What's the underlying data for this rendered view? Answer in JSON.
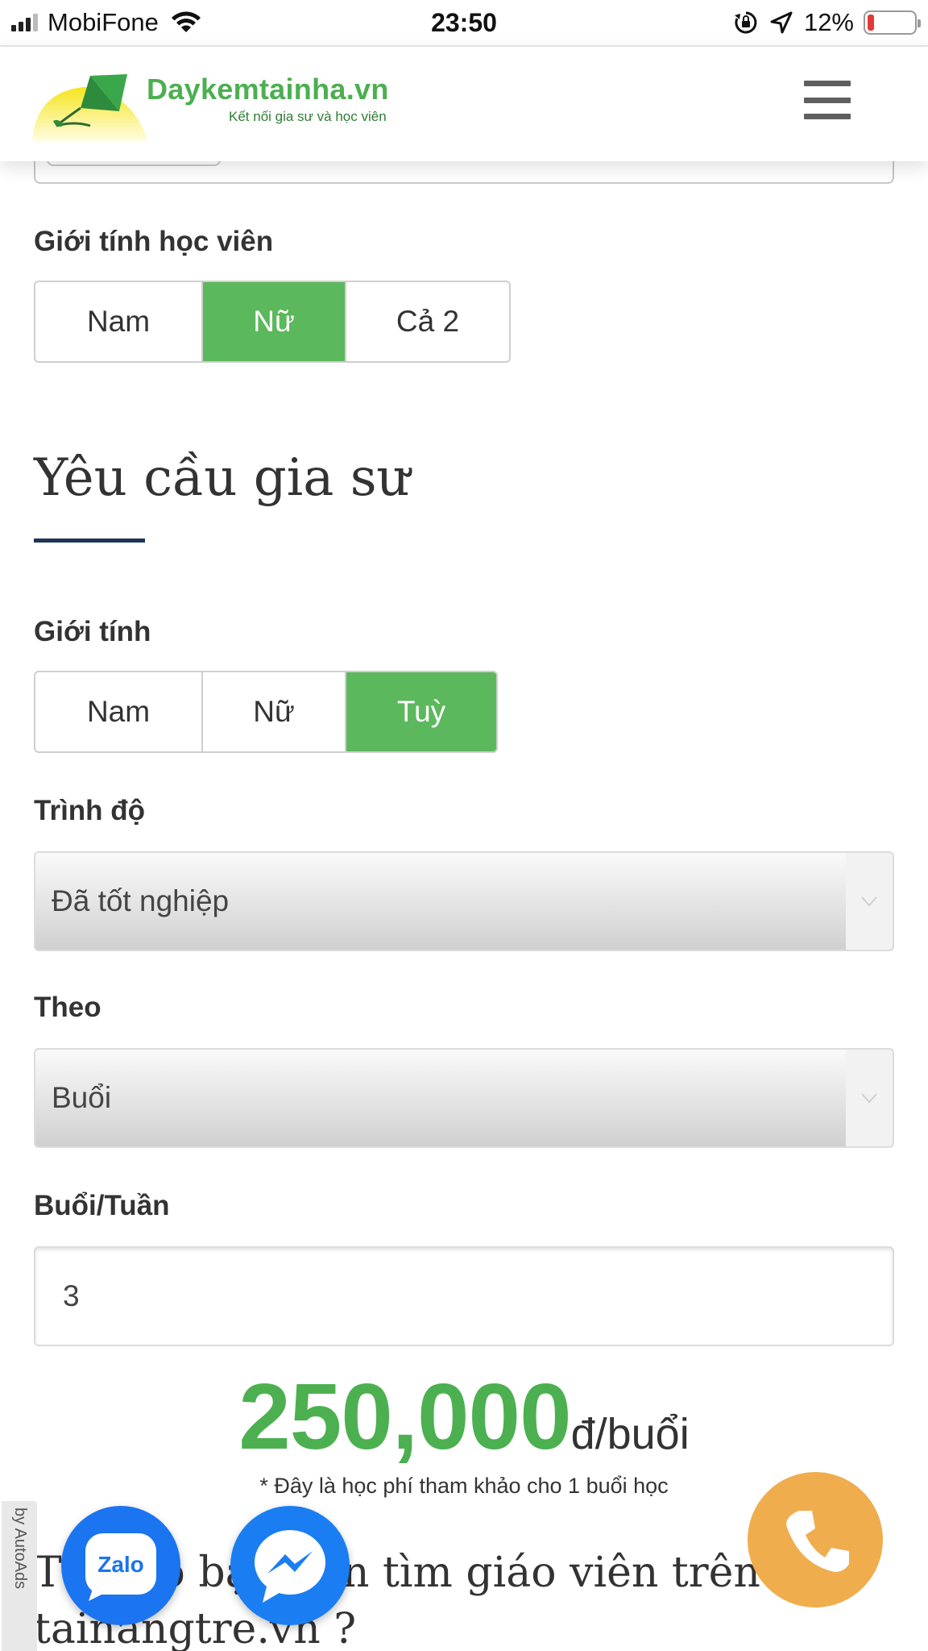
{
  "status_bar": {
    "carrier": "MobiFone",
    "time": "23:50",
    "battery_percent": "12%",
    "battery_level": 0.12,
    "battery_color": "#e53935"
  },
  "header": {
    "logo_name": "Daykemtainha.vn",
    "logo_tagline": "Kết nối gia sư và học viên",
    "menu_icon": "hamburger-menu-icon"
  },
  "student_gender": {
    "label": "Giới tính học viên",
    "options": [
      "Nam",
      "Nữ",
      "Cả 2"
    ],
    "selected": "Nữ"
  },
  "tutor_requirements": {
    "title": "Yêu cầu gia sư",
    "gender": {
      "label": "Giới tính",
      "options": [
        "Nam",
        "Nữ",
        "Tuỳ"
      ],
      "selected": "Tuỳ"
    },
    "level": {
      "label": "Trình độ",
      "value": "Đã tốt nghiệp"
    },
    "by": {
      "label": "Theo",
      "value": "Buổi"
    },
    "sessions_per_week": {
      "label": "Buổi/Tuần",
      "value": "3"
    }
  },
  "price": {
    "amount": "250,000",
    "unit": "đ/buổi",
    "note": "* Đây là học phí tham khảo cho 1 buổi học"
  },
  "question": {
    "line1": "Tại sao bạn nên tìm giáo viên trên",
    "line2": "tainangtre.vn ?"
  },
  "floating": {
    "autoads_label": "by AutoAds",
    "zalo_label": "Zalo",
    "accent_green": "#5cb85c",
    "phone_color": "#f0ad4e"
  }
}
